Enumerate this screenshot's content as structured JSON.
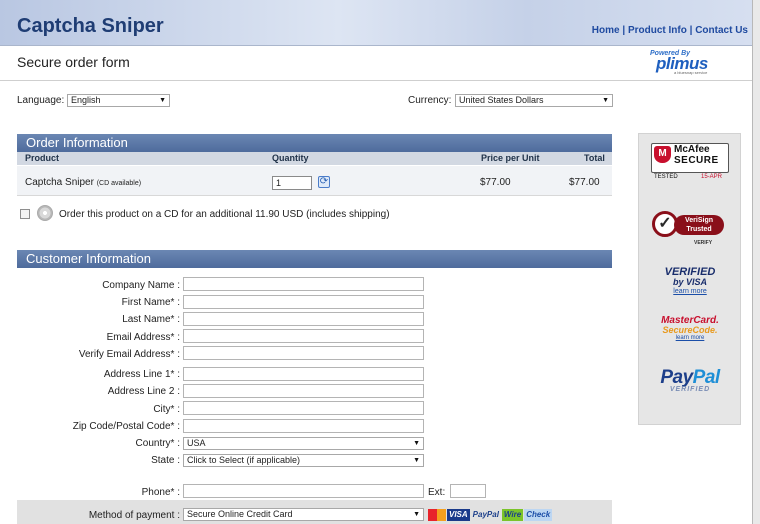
{
  "header": {
    "title": "Captcha Sniper",
    "nav": [
      "Home",
      "Product Info",
      "Contact Us"
    ],
    "separator": "|"
  },
  "subheader": {
    "title": "Secure order form",
    "powered_small": "Powered By",
    "powered_brand": "plimus",
    "powered_tag": "a bluesnap service"
  },
  "language": {
    "label": "Language:",
    "value": "English"
  },
  "currency": {
    "label": "Currency:",
    "value": "United States Dollars"
  },
  "order": {
    "title": "Order Information",
    "columns": [
      "Product",
      "Quantity",
      "Price per Unit",
      "Total"
    ],
    "row": {
      "product": "Captcha Sniper",
      "product_note": "(CD available)",
      "quantity": "1",
      "price": "$77.00",
      "total": "$77.00"
    },
    "cd_option": "Order this product on a CD for an additional 11.90 USD  (includes shipping)"
  },
  "customer": {
    "title": "Customer Information",
    "fields": {
      "company": "Company Name :",
      "first_name": "First Name* :",
      "last_name": "Last Name* :",
      "email": "Email Address* :",
      "verify_email": "Verify Email Address* :",
      "address1": "Address Line 1* :",
      "address2": "Address Line 2 :",
      "city": "City* :",
      "zip": "Zip Code/Postal Code* :",
      "country": "Country* :",
      "state": "State :",
      "phone": "Phone* :",
      "ext": "Ext:",
      "payment": "Method of payment :"
    },
    "country_value": "USA",
    "state_value": "Click to Select (if applicable)",
    "payment_value": "Secure Online Credit Card",
    "payment_cards": [
      "VISA",
      "PayPal",
      "Wire",
      "Check"
    ]
  },
  "trust": {
    "mcafee_line1": "McAfee",
    "mcafee_line2": "SECURE",
    "mcafee_tested": "TESTED",
    "mcafee_date": "15-APR",
    "verisign_badge": "VeriSign Trusted",
    "verisign_verify": "VERIFY",
    "vbv_line1": "VERIFIED",
    "vbv_line2": "by VISA",
    "vbv_learn": "learn more",
    "mc_line1": "MasterCard.",
    "mc_line2": "SecureCode.",
    "mc_learn": "learn more",
    "paypal_pay": "Pay",
    "paypal_pal": "Pal",
    "paypal_verified": "VERIFIED"
  },
  "colors": {
    "brand": "#1f3d74",
    "section_bar": "#5a77a7",
    "link": "#1f4aa0"
  }
}
